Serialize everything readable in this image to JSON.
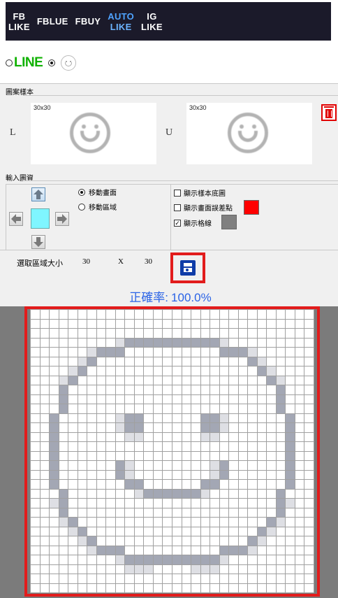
{
  "nav": {
    "tabs": [
      {
        "line1": "FB",
        "line2": "LIKE",
        "active": false
      },
      {
        "line1": "FBLUE",
        "line2": "",
        "active": false
      },
      {
        "line1": "FBUY",
        "line2": "",
        "active": false
      },
      {
        "line1": "AUTO",
        "line2": "LIKE",
        "active": true
      },
      {
        "line1": "IG",
        "line2": "LIKE",
        "active": false
      }
    ]
  },
  "source": {
    "line_label": "LINE",
    "selected": "smiley"
  },
  "sample": {
    "section_label": "圖案樣本",
    "left_letter": "L",
    "right_letter": "U",
    "left_size": "30x30",
    "right_size": "30x30"
  },
  "input": {
    "section_label": "輸入圖資",
    "move_screen": "移動畫面",
    "move_area": "移動區域",
    "show_sample_bg": "顯示樣本底圖",
    "show_error_points": "顯示畫面誤差點",
    "show_grid": "顯示格線",
    "error_color": "#ff0000",
    "grid_color": "#808080",
    "select_area_label": "選取區域大小",
    "width": "30",
    "x_sep": "X",
    "height": "30"
  },
  "result": {
    "accuracy_label": "正確率:",
    "accuracy_value": "100.0%"
  },
  "pixel_grid": {
    "cols": 30,
    "rows": 30,
    "dark_color": "#a3a7b4",
    "light_color": "#dedfe4",
    "cells_dark": [
      [
        3,
        10
      ],
      [
        3,
        11
      ],
      [
        3,
        12
      ],
      [
        3,
        13
      ],
      [
        3,
        14
      ],
      [
        3,
        15
      ],
      [
        3,
        16
      ],
      [
        3,
        17
      ],
      [
        3,
        18
      ],
      [
        3,
        19
      ],
      [
        4,
        7
      ],
      [
        4,
        8
      ],
      [
        4,
        9
      ],
      [
        4,
        20
      ],
      [
        4,
        21
      ],
      [
        4,
        22
      ],
      [
        5,
        6
      ],
      [
        5,
        23
      ],
      [
        6,
        5
      ],
      [
        6,
        24
      ],
      [
        7,
        4
      ],
      [
        7,
        25
      ],
      [
        8,
        3
      ],
      [
        8,
        26
      ],
      [
        9,
        3
      ],
      [
        9,
        26
      ],
      [
        10,
        3
      ],
      [
        10,
        26
      ],
      [
        11,
        2
      ],
      [
        11,
        10
      ],
      [
        11,
        11
      ],
      [
        11,
        18
      ],
      [
        11,
        19
      ],
      [
        11,
        27
      ],
      [
        12,
        2
      ],
      [
        12,
        10
      ],
      [
        12,
        11
      ],
      [
        12,
        18
      ],
      [
        12,
        19
      ],
      [
        12,
        27
      ],
      [
        13,
        2
      ],
      [
        13,
        27
      ],
      [
        14,
        2
      ],
      [
        14,
        27
      ],
      [
        15,
        2
      ],
      [
        15,
        27
      ],
      [
        16,
        2
      ],
      [
        16,
        9
      ],
      [
        16,
        20
      ],
      [
        16,
        27
      ],
      [
        17,
        2
      ],
      [
        17,
        9
      ],
      [
        17,
        20
      ],
      [
        17,
        27
      ],
      [
        18,
        2
      ],
      [
        18,
        10
      ],
      [
        18,
        11
      ],
      [
        18,
        18
      ],
      [
        18,
        19
      ],
      [
        18,
        27
      ],
      [
        19,
        3
      ],
      [
        19,
        12
      ],
      [
        19,
        13
      ],
      [
        19,
        14
      ],
      [
        19,
        15
      ],
      [
        19,
        16
      ],
      [
        19,
        17
      ],
      [
        19,
        26
      ],
      [
        20,
        3
      ],
      [
        20,
        26
      ],
      [
        21,
        3
      ],
      [
        21,
        26
      ],
      [
        22,
        4
      ],
      [
        22,
        25
      ],
      [
        23,
        5
      ],
      [
        23,
        24
      ],
      [
        24,
        6
      ],
      [
        24,
        23
      ],
      [
        25,
        7
      ],
      [
        25,
        8
      ],
      [
        25,
        9
      ],
      [
        25,
        20
      ],
      [
        25,
        21
      ],
      [
        25,
        22
      ],
      [
        26,
        10
      ],
      [
        26,
        11
      ],
      [
        26,
        12
      ],
      [
        26,
        13
      ],
      [
        26,
        14
      ],
      [
        26,
        15
      ],
      [
        26,
        16
      ],
      [
        26,
        17
      ],
      [
        26,
        18
      ],
      [
        26,
        19
      ]
    ],
    "cells_light": [
      [
        3,
        9
      ],
      [
        3,
        20
      ],
      [
        4,
        6
      ],
      [
        4,
        23
      ],
      [
        5,
        5
      ],
      [
        5,
        24
      ],
      [
        6,
        4
      ],
      [
        6,
        25
      ],
      [
        7,
        3
      ],
      [
        7,
        26
      ],
      [
        11,
        9
      ],
      [
        11,
        20
      ],
      [
        12,
        9
      ],
      [
        12,
        20
      ],
      [
        13,
        10
      ],
      [
        13,
        11
      ],
      [
        13,
        18
      ],
      [
        13,
        19
      ],
      [
        16,
        10
      ],
      [
        16,
        19
      ],
      [
        17,
        10
      ],
      [
        17,
        19
      ],
      [
        19,
        11
      ],
      [
        19,
        18
      ],
      [
        20,
        2
      ],
      [
        20,
        27
      ],
      [
        22,
        3
      ],
      [
        22,
        26
      ],
      [
        23,
        4
      ],
      [
        23,
        25
      ],
      [
        24,
        5
      ],
      [
        24,
        24
      ],
      [
        25,
        6
      ],
      [
        25,
        23
      ],
      [
        26,
        9
      ],
      [
        26,
        20
      ],
      [
        27,
        10
      ],
      [
        27,
        11
      ],
      [
        27,
        12
      ],
      [
        27,
        17
      ],
      [
        27,
        18
      ],
      [
        27,
        19
      ]
    ]
  }
}
